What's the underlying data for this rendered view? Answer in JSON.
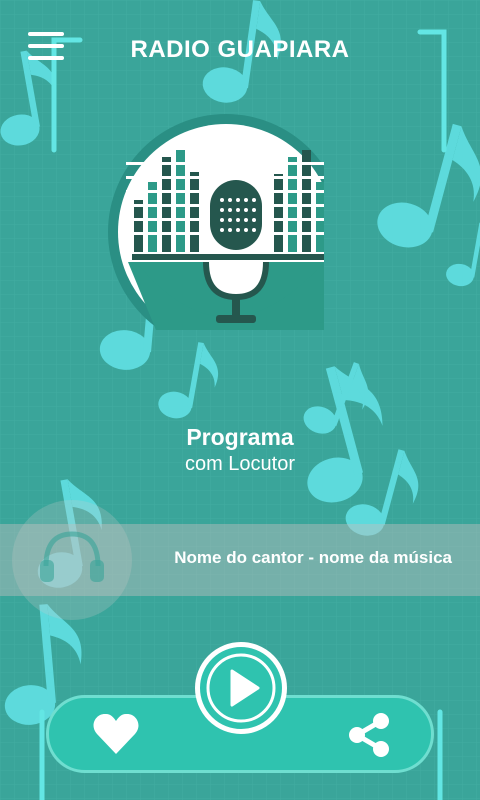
{
  "header": {
    "title": "RADIO GUAPIARA",
    "menu_icon": "hamburger-menu-icon"
  },
  "logo": {
    "icon": "microphone-equalizer-logo"
  },
  "program": {
    "name": "Programa",
    "host": "com Locutor"
  },
  "now_playing": {
    "song": "Nome do cantor - nome da música",
    "icon": "headphones-icon"
  },
  "controls": {
    "like_icon": "heart-icon",
    "play_icon": "play-icon",
    "share_icon": "share-icon"
  },
  "colors": {
    "background": "#3aa59a",
    "accent": "#2fc3af",
    "note": "#5fdde0",
    "dark": "#25574e"
  }
}
